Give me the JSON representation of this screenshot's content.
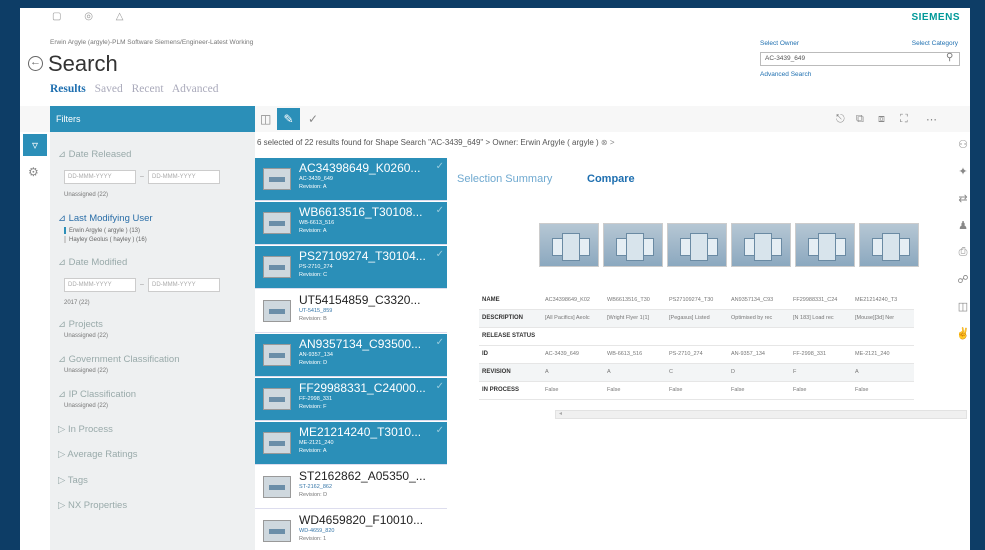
{
  "brand": "SIEMENS",
  "breadcrumb": "Erwin Argyle (argyle)-PLM Software Siemens/Engineer-Latest Working",
  "page_title": "Search",
  "tabs": [
    {
      "label": "Results",
      "active": true
    },
    {
      "label": "Saved",
      "active": false
    },
    {
      "label": "Recent",
      "active": false
    },
    {
      "label": "Advanced",
      "active": false
    }
  ],
  "search": {
    "owner_label": "Select Owner",
    "category_label": "Select Category",
    "owner_value": "AC-3439_649",
    "advanced_link": "Advanced Search"
  },
  "filters": {
    "title": "Filters",
    "date_released": "Date Released",
    "date_placeholder": "DD-MMM-YYYY",
    "unassigned_count": "Unassigned (22)",
    "last_modifying_user": "Last Modifying User",
    "users": [
      "Erwin Argyle ( argyle ) (13)",
      "Hayley Geolus ( hayley ) (16)"
    ],
    "date_modified": "Date Modified",
    "year_value": "2017 (22)",
    "projects": "Projects",
    "projects_value": "Unassigned (22)",
    "gov_class": "Government Classification",
    "gov_value": "Unassigned (22)",
    "ip_class": "IP Classification",
    "ip_value": "Unassigned (22)",
    "in_process": "In Process",
    "avg_ratings": "Average Ratings",
    "tags": "Tags",
    "nx_props": "NX Properties"
  },
  "status": {
    "text": "6 selected of 22 results found for Shape Search \"AC-3439_649\"",
    "chevron": ">",
    "owner_text": "Owner: Erwin Argyle ( argyle )"
  },
  "results": [
    {
      "name": "AC34398649_K0260...",
      "id": "AC-3439_649",
      "rev": "Revision: A",
      "selected": true
    },
    {
      "name": "WB6613516_T30108...",
      "id": "WB-6613_516",
      "rev": "Revision: A",
      "selected": true
    },
    {
      "name": "PS27109274_T30104...",
      "id": "PS-2710_274",
      "rev": "Revision: C",
      "selected": true
    },
    {
      "name": "UT54154859_C3320...",
      "id": "UT-5415_859",
      "rev": "Revision: B",
      "selected": false
    },
    {
      "name": "AN9357134_C93500...",
      "id": "AN-9357_134",
      "rev": "Revision: D",
      "selected": true
    },
    {
      "name": "FF29988331_C24000...",
      "id": "FF-2998_331",
      "rev": "Revision: F",
      "selected": true
    },
    {
      "name": "ME21214240_T3010...",
      "id": "ME-2121_240",
      "rev": "Revision: A",
      "selected": true
    },
    {
      "name": "ST2162862_A05350_...",
      "id": "ST-2162_862",
      "rev": "Revision: D",
      "selected": false
    },
    {
      "name": "WD4659820_F10010...",
      "id": "WD-4659_820",
      "rev": "Revision: 1",
      "selected": false
    }
  ],
  "detail": {
    "tab_summary": "Selection Summary",
    "tab_compare": "Compare",
    "row_labels": [
      "NAME",
      "DESCRIPTION",
      "RELEASE STATUS",
      "ID",
      "REVISION",
      "IN PROCESS"
    ],
    "columns": [
      {
        "name": "AC34398649_K02",
        "description": "[All Pacifics] Aeolc",
        "release": "",
        "id": "AC-3439_649",
        "revision": "A",
        "in_process": "False"
      },
      {
        "name": "WB6613516_T30",
        "description": "[Wright Flyer 1(1]",
        "release": "",
        "id": "WB-6613_516",
        "revision": "A",
        "in_process": "False"
      },
      {
        "name": "PS27109274_T30",
        "description": "[Pegasus] Listed",
        "release": "",
        "id": "PS-2710_274",
        "revision": "C",
        "in_process": "False"
      },
      {
        "name": "AN9357134_C93",
        "description": "Optimised by rec",
        "release": "",
        "id": "AN-9357_134",
        "revision": "D",
        "in_process": "False"
      },
      {
        "name": "FF29988331_C24",
        "description": "[N 183] Load rec",
        "release": "",
        "id": "FF-2998_331",
        "revision": "F",
        "in_process": "False"
      },
      {
        "name": "ME21214240_T3",
        "description": "[Mouse][3d] Ner",
        "release": "",
        "id": "ME-2121_240",
        "revision": "A",
        "in_process": "False"
      }
    ]
  }
}
